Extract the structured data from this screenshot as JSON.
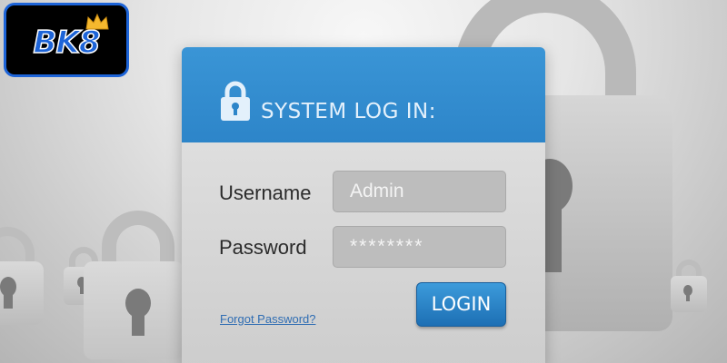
{
  "logo": {
    "text": "BK8"
  },
  "login_panel": {
    "title": "SYSTEM LOG IN:",
    "username": {
      "label": "Username",
      "value": "Admin"
    },
    "password": {
      "label": "Password",
      "value": "********"
    },
    "forgot_password": "Forgot Password?",
    "login_button": "LOGIN"
  },
  "colors": {
    "header_blue": "#2d85c9",
    "button_blue": "#1d6fb4",
    "logo_blue": "#1d64d8",
    "crown_gold": "#f5b82e"
  }
}
